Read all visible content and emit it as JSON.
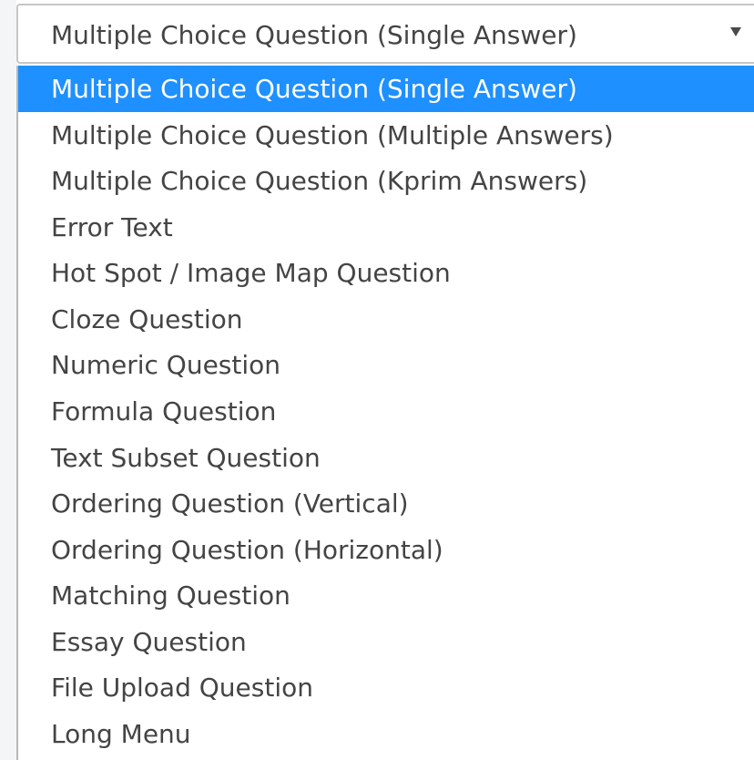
{
  "select": {
    "value": "Multiple Choice Question (Single Answer)",
    "caret_icon": "caret-down-icon"
  },
  "dropdown": {
    "highlight_color": "#1e90ff",
    "options": [
      {
        "label": "Multiple Choice Question (Single Answer)",
        "selected": true
      },
      {
        "label": "Multiple Choice Question (Multiple Answers)",
        "selected": false
      },
      {
        "label": "Multiple Choice Question (Kprim Answers)",
        "selected": false
      },
      {
        "label": "Error Text",
        "selected": false
      },
      {
        "label": "Hot Spot / Image Map Question",
        "selected": false
      },
      {
        "label": "Cloze Question",
        "selected": false
      },
      {
        "label": "Numeric Question",
        "selected": false
      },
      {
        "label": "Formula Question",
        "selected": false
      },
      {
        "label": "Text Subset Question",
        "selected": false
      },
      {
        "label": "Ordering Question (Vertical)",
        "selected": false
      },
      {
        "label": "Ordering Question (Horizontal)",
        "selected": false
      },
      {
        "label": "Matching Question",
        "selected": false
      },
      {
        "label": "Essay Question",
        "selected": false
      },
      {
        "label": "File Upload Question",
        "selected": false
      },
      {
        "label": "Long Menu",
        "selected": false
      }
    ]
  }
}
